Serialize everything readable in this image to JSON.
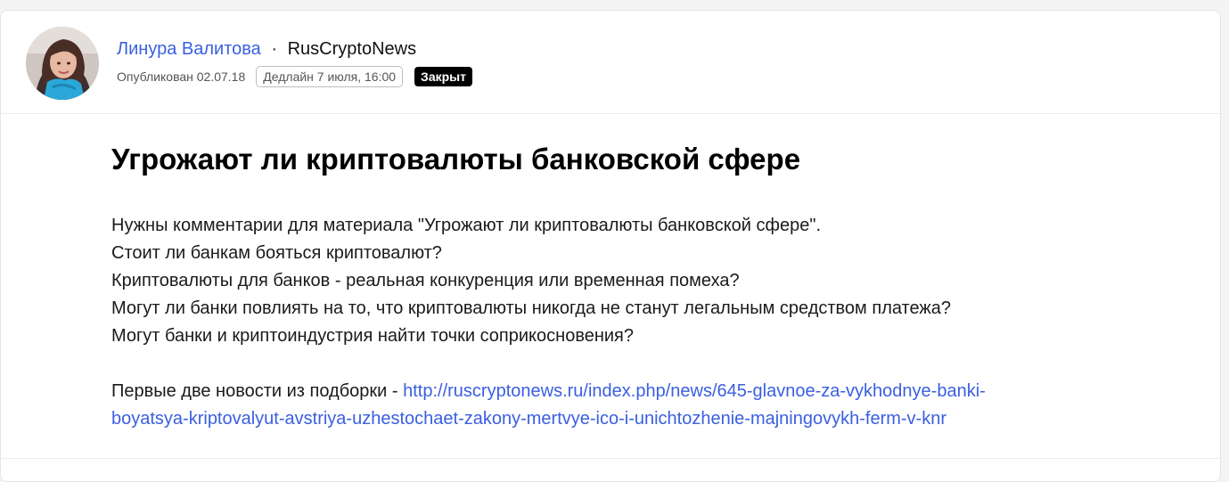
{
  "author": {
    "name": "Линура Валитова",
    "separator": "·",
    "company": "RusCryptoNews"
  },
  "meta": {
    "published": "Опубликован 02.07.18",
    "deadline": "Дедлайн 7 июля, 16:00",
    "status": "Закрыт"
  },
  "post": {
    "title": "Угрожают ли криптовалюты банковской сфере",
    "lines": [
      "Нужны комментарии для материала \"Угрожают ли криптовалюты банковской сфере\".",
      "Стоит ли банкам бояться криптовалют?",
      "Криптовалюты для банков - реальная конкуренция или временная помеха?",
      "Могут ли банки повлиять на то, что криптовалюты никогда не станут легальным средством платежа?",
      "Могут банки и криптоиндустрия найти точки соприкосновения?"
    ],
    "news_prefix": "Первые две новости из подборки - ",
    "news_link_line1": "http://ruscryptonews.ru/index.php/news/645-glavnoe-za-vykhodnye-banki-",
    "news_link_line2": "boyatsya-kriptovalyut-avstriya-uzhestochaet-zakony-mertvye-ico-i-unichtozhenie-majningovykh-ferm-v-knr"
  },
  "colors": {
    "link": "#3a5fe0",
    "status_bg": "#000000"
  }
}
